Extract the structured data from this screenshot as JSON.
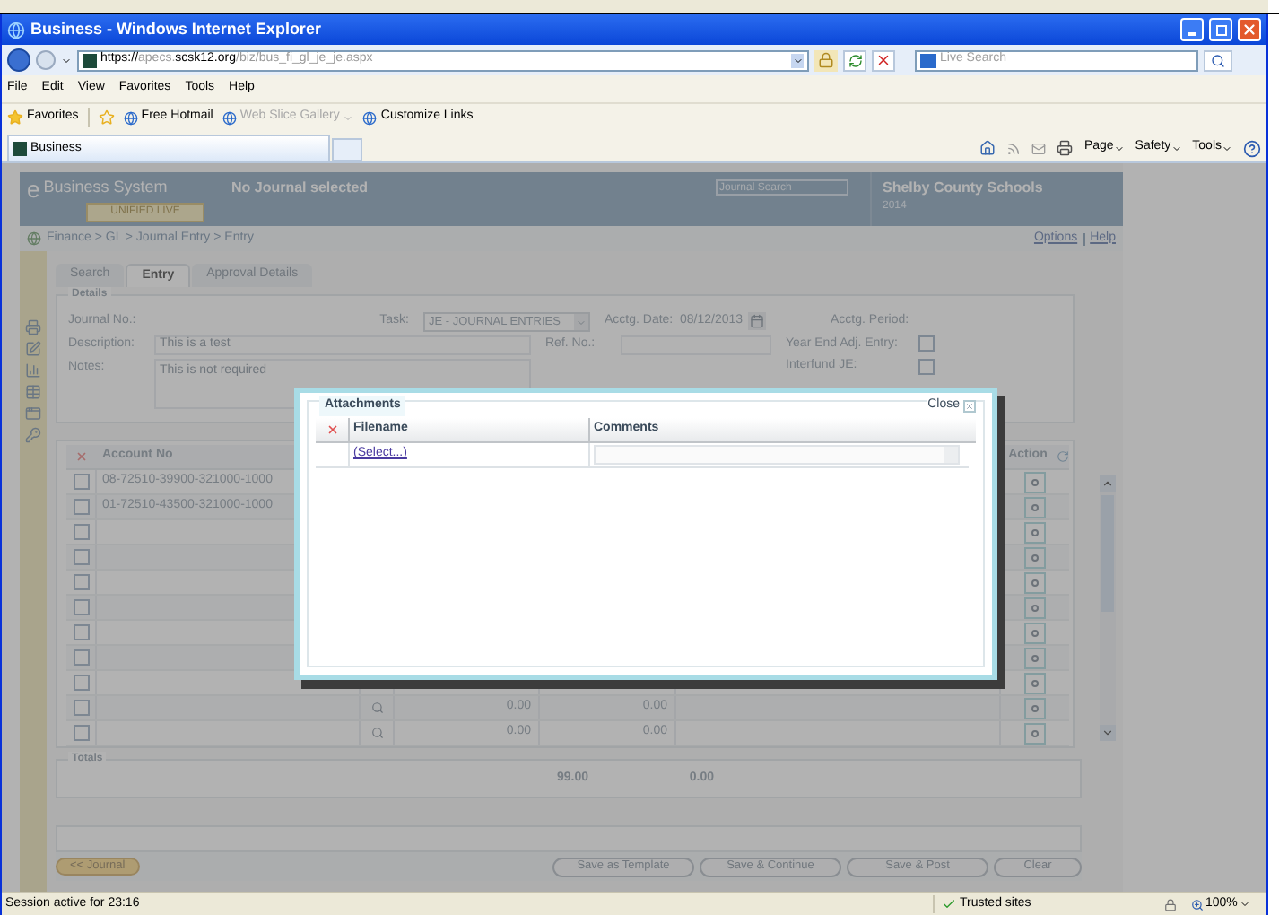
{
  "window": {
    "title": "Business - Windows Internet Explorer"
  },
  "address_bar": {
    "url_parts": [
      {
        "text": "https://",
        "emphasis": true
      },
      {
        "text": "apecs.",
        "emphasis": false
      },
      {
        "text": "scsk12.org",
        "emphasis": true
      },
      {
        "text": "/biz/bus_fi_gl_je_je.aspx",
        "emphasis": false
      }
    ]
  },
  "search": {
    "placeholder": "Live Search"
  },
  "menu": [
    "File",
    "Edit",
    "View",
    "Favorites",
    "Tools",
    "Help"
  ],
  "favorites_bar": {
    "label": "Favorites",
    "links": [
      {
        "label": "Free Hotmail",
        "disabled": false
      },
      {
        "label": "Web Slice Gallery",
        "disabled": true
      },
      {
        "label": "Customize Links",
        "disabled": false
      }
    ]
  },
  "browser_tabs": [
    {
      "label": "Business",
      "selected": true
    }
  ],
  "command_bar": [
    "Page",
    "Safety",
    "Tools"
  ],
  "app_header": {
    "logo": "e",
    "product": "Business System",
    "environment": "UNIFIED LIVE",
    "journal_status": "No Journal selected",
    "search_placeholder": "Journal Search",
    "organization": "Shelby County Schools",
    "year": "2014"
  },
  "breadcrumb": "Finance > GL > Journal Entry > Entry",
  "header_links": [
    "Options",
    "Help"
  ],
  "page_tabs": [
    {
      "label": "Search",
      "selected": false
    },
    {
      "label": "Entry",
      "selected": true
    },
    {
      "label": "Approval Details",
      "selected": false
    }
  ],
  "details": {
    "legend": "Details",
    "journal_no": {
      "label": "Journal No.:"
    },
    "task": {
      "label": "Task:",
      "value": "JE - JOURNAL ENTRIES"
    },
    "acctg_date": {
      "label": "Acctg. Date:",
      "value": "08/12/2013"
    },
    "acctg_period": {
      "label": "Acctg. Period:"
    },
    "description": {
      "label": "Description:",
      "value": "This is a test"
    },
    "ref_no": {
      "label": "Ref. No.:"
    },
    "year_end_adj": {
      "label": "Year End Adj. Entry:",
      "checked": false
    },
    "notes": {
      "label": "Notes:",
      "value": "This is not required"
    },
    "interfund_je": {
      "label": "Interfund JE:",
      "checked": false
    }
  },
  "grid": {
    "columns": [
      "Account No",
      "Action"
    ],
    "rows": [
      {
        "checked": false,
        "account": "08-72510-39900-321000-1000"
      },
      {
        "checked": false,
        "account": "01-72510-43500-321000-1000"
      },
      {
        "checked": false
      },
      {
        "checked": false
      },
      {
        "checked": false
      },
      {
        "checked": false
      },
      {
        "checked": false
      },
      {
        "checked": false
      },
      {
        "checked": false
      },
      {
        "checked": false,
        "debit": "0.00",
        "credit": "0.00"
      },
      {
        "checked": false,
        "debit": "0.00",
        "credit": "0.00"
      }
    ]
  },
  "totals": {
    "legend": "Totals",
    "debit": "99.00",
    "credit": "0.00"
  },
  "buttons": {
    "back": "<< Journal",
    "actions": [
      "Save as Template",
      "Save & Continue",
      "Save & Post",
      "Clear"
    ]
  },
  "attachments_dialog": {
    "title": "Attachments",
    "close": "Close",
    "columns": [
      "Filename",
      "Comments"
    ],
    "rows": [
      {
        "filename": "(Select...)"
      }
    ]
  },
  "status_bar": {
    "text": "Session active for 23:16",
    "zone": "Trusted sites",
    "zoom": "100%"
  }
}
